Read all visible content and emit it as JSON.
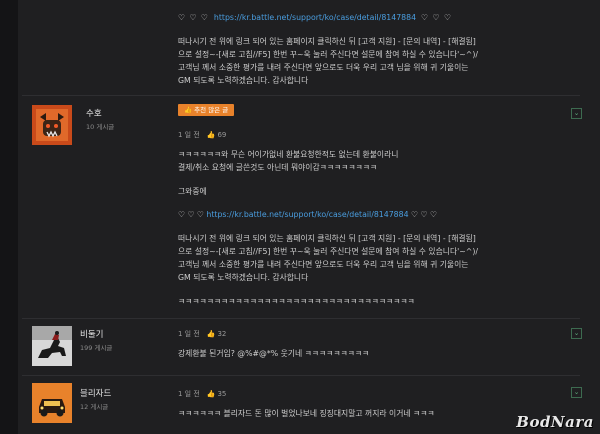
{
  "top_post": {
    "link_line_hearts_left": "♡ ♡ ♡",
    "link": "https://kr.battle.net/support/ko/case/detail/8147884",
    "link_line_hearts_right": "♡ ♡ ♡",
    "body_lines": [
      "떠나시기 전 위에 링크 되어 있는 홈페이지 클릭하신 뒤 [고객 지원] - [문의 내역] - [해결됨]",
      "으로 설정~-[새로 고침//F5] 한번 꾸~욱 눌러 주신다면 설문에 참여 하실 수 있습니다'~^)/",
      "고객님 께서 소중한 평가를 내려 주신다면 앞으로도 더욱 우리 고객 님을 위해 귀 기울이는",
      "GM 되도록 노력하겠습니다. 감사합니다"
    ]
  },
  "comments": [
    {
      "username": "수호",
      "post_count": "10 게시글",
      "badge": "추천 많은 글",
      "time": "1 일 전",
      "likes": "69",
      "lines": [
        "ㅋㅋㅋㅋㅋㅋ와 무슨 어이가없네 환불요청한적도 없는데 환불이라니",
        "결제/취소 요청에 글쓴것도 아닌데 뭐야이감ㅋㅋㅋㅋㅋㅋㅋㅋ",
        "",
        "그와중에",
        "",
        "♡ ♡ ♡  https://kr.battle.net/support/ko/case/detail/8147884  ♡ ♡ ♡",
        "",
        "떠나시기 전 위에 링크 되어 있는 홈페이지 클릭하신 뒤 [고객 지원] - [문의 내역] - [해결됨]",
        "으로 설정~-[새로 고침//F5] 한번 꾸~욱 눌러 주신다면 설문에 참여 하실 수 있습니다'~^)/",
        "고객님 께서 소중한 평가를 내려 주신다면 앞으로도 더욱 우리 고객 님을 위해 귀 기울이는",
        "GM 되도록 노력하겠습니다. 감사합니다",
        "",
        "ㅋㅋㅋㅋㅋㅋㅋㅋㅋㅋㅋㅋㅋㅋㅋㅋㅋㅋㅋㅋㅋㅋㅋㅋㅋㅋㅋㅋㅋㅋㅋㅋㅋ"
      ]
    },
    {
      "username": "비둘기",
      "post_count": "199 게시글",
      "time": "1 일 전",
      "likes": "32",
      "lines": [
        "강제환불 된거임? @%#@*% 웃기네 ㅋㅋㅋㅋㅋㅋㅋㅋㅋ"
      ]
    },
    {
      "username": "블리자드",
      "post_count": "12 게시글",
      "time": "1 일 전",
      "likes": "35",
      "lines": [
        "ㅋㅋㅋㅋㅋㅋ 블리자드 돈 많이 벌었나보네 징징대지말고 꺼지라 이거네 ㅋㅋㅋ"
      ]
    }
  ],
  "watermark": "BodNara",
  "colors": {
    "link": "#4a9ee0",
    "badge": "#e8822b",
    "like_icon": "#e2a24a",
    "background": "#1f1f21"
  }
}
